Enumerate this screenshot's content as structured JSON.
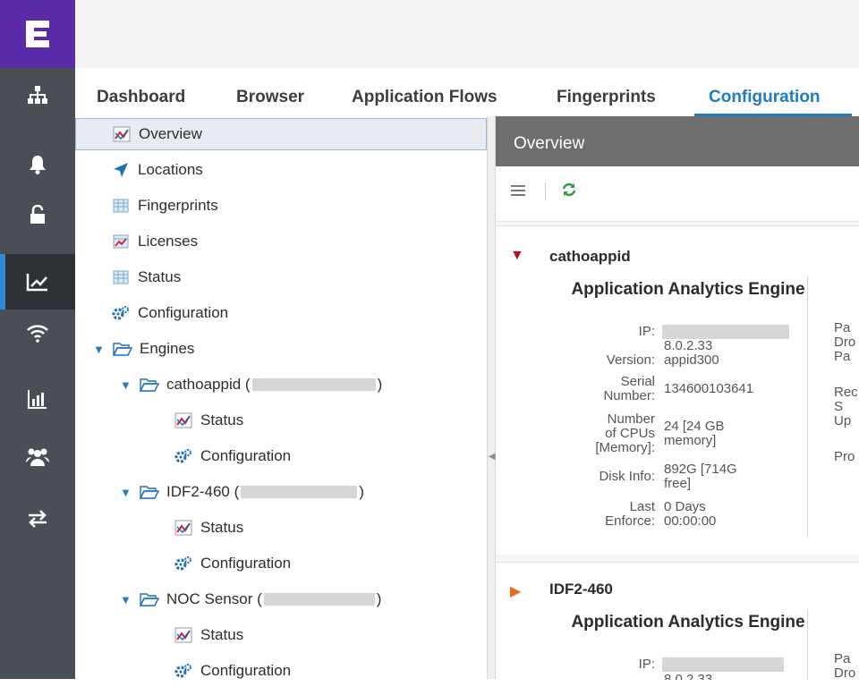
{
  "tabs": [
    "Dashboard",
    "Browser",
    "Application Flows",
    "Fingerprints",
    "Configuration"
  ],
  "active_tab": "Configuration",
  "rail": {
    "logo_icon": "extreme-logo-icon",
    "items": [
      "network-icon",
      "bell-icon",
      "lock-icon",
      "analytics-icon",
      "wifi-icon",
      "reports-icon",
      "users-icon",
      "transfer-icon"
    ],
    "active_item": "analytics-icon"
  },
  "tree": {
    "overview": "Overview",
    "locations": "Locations",
    "fingerprints": "Fingerprints",
    "licenses": "Licenses",
    "status": "Status",
    "configuration": "Configuration",
    "engines": "Engines",
    "engine1": {
      "name": "cathoappid (",
      "close": ")",
      "status": "Status",
      "configuration": "Configuration"
    },
    "engine2": {
      "name": "IDF2-460 (",
      "close": ")",
      "status": "Status",
      "configuration": "Configuration"
    },
    "engine3": {
      "name": "NOC Sensor (",
      "close": ")",
      "status": "Status",
      "configuration": "Configuration"
    }
  },
  "panel": {
    "title": "Overview",
    "toolbar": {
      "menu_icon": "menu-icon",
      "refresh_icon": "refresh-icon"
    }
  },
  "cards": [
    {
      "name": "cathoappid",
      "title": "Application Analytics Engine",
      "rows": [
        {
          "label": "IP:",
          "value": ""
        },
        {
          "label": "Version:",
          "value": "8.0.2.33\nappid300"
        },
        {
          "label": "Serial\nNumber:",
          "value": "134600103641"
        },
        {
          "label": "Number\nof CPUs\n[Memory]:",
          "value": "24 [24 GB\nmemory]"
        },
        {
          "label": "Disk Info:",
          "value": "892G [714G\nfree]"
        },
        {
          "label": "Last\nEnforce:",
          "value": "0 Days\n00:00:00"
        }
      ],
      "truncated": [
        "Pa",
        "Dro",
        "Pa",
        "Rec",
        "S",
        "Up",
        "Pro"
      ]
    },
    {
      "name": "IDF2-460",
      "title": "Application Analytics Engine",
      "rows": [
        {
          "label": "IP:",
          "value": ""
        },
        {
          "label": "",
          "value": "8.0.2.33"
        }
      ],
      "truncated": [
        "Pa",
        "Dro"
      ]
    }
  ],
  "colors": {
    "accent": "#1f7bc2",
    "brand": "#5b2aa6",
    "rail": "#4a4e55",
    "alarm_red": "#b3141b",
    "warn_orange": "#e86a1a",
    "config_blue": "#1f6fb8"
  }
}
